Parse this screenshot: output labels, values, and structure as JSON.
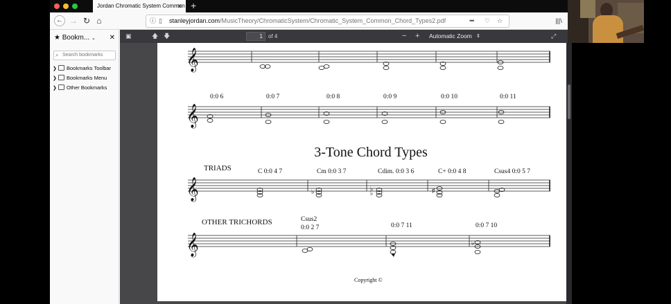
{
  "tab": {
    "title": "Jordan Chromatic System Common",
    "close": "✕",
    "new": "+"
  },
  "nav": {
    "back": "←",
    "forward": "→",
    "reload": "↻",
    "home": "⌂",
    "url_domain": "stanleyjordan.com",
    "url_path": "/MusicTheory/ChromaticSystem/Chromatic_System_Common_Chord_Types2.pdf",
    "more": "•••",
    "library": "|||\\"
  },
  "sidebar": {
    "title": "Bookm...",
    "search_placeholder": "Search bookmarks",
    "items": [
      {
        "label": "Bookmarks Toolbar"
      },
      {
        "label": "Bookmarks Menu"
      },
      {
        "label": "Other Bookmarks"
      }
    ]
  },
  "pdf": {
    "page_current": "1",
    "page_total": "of 4",
    "zoom_minus": "−",
    "zoom_plus": "+",
    "zoom": "Automatic Zoom"
  },
  "sheet": {
    "row_top_labels": [
      "0:0 6",
      "0:0 7",
      "0:0 8",
      "0:0 9",
      "0:0 10",
      "0:0 11"
    ],
    "heading": "3-Tone Chord Types",
    "triads_label": "TRIADS",
    "triads": [
      "C  0:0 4 7",
      "Cm  0:0 3 7",
      "Cdim.  0:0 3 6",
      "C+  0:0 4 8",
      "Csus4  0:0 5 7"
    ],
    "other_label": "OTHER TRICHORDS",
    "other": [
      {
        "name": "Csus2",
        "code": "0:0 2 7"
      },
      {
        "name": "",
        "code": "0:0 7 11"
      },
      {
        "name": "",
        "code": "0:0 7 10"
      }
    ],
    "copyright": "Copyright ©"
  }
}
